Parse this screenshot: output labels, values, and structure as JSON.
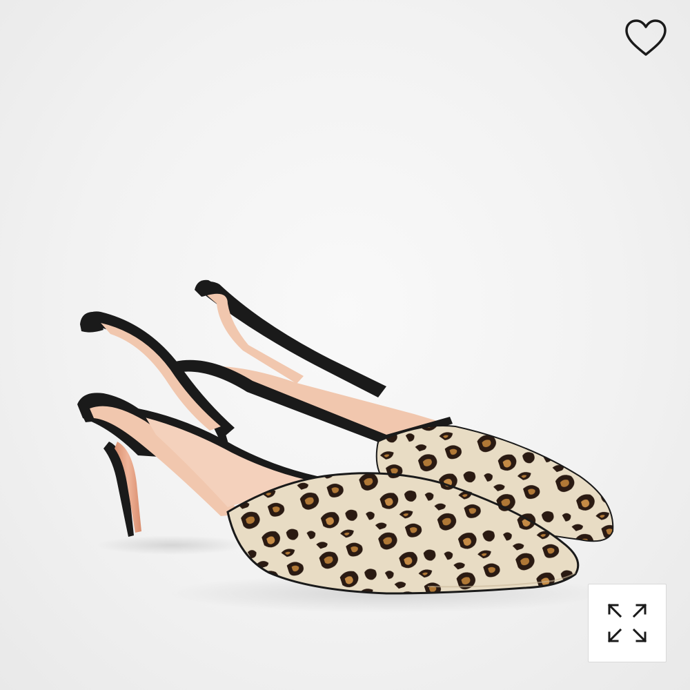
{
  "product_image": {
    "alt": "",
    "background_color": "#f2f2f2",
    "upper_color": "#1a1a1a",
    "lining_color": "#f1c7ae",
    "heel_color": "#f0b59a",
    "print_base_color": "#e8dcc4",
    "print_spot_color": "#2a1a12",
    "print_accent_color": "#b07836"
  },
  "wishlist": {
    "icon": "heart-outline-icon",
    "color": "#1a1a1a"
  },
  "expand": {
    "icon": "expand-arrows-icon",
    "color": "#1a1a1a"
  }
}
